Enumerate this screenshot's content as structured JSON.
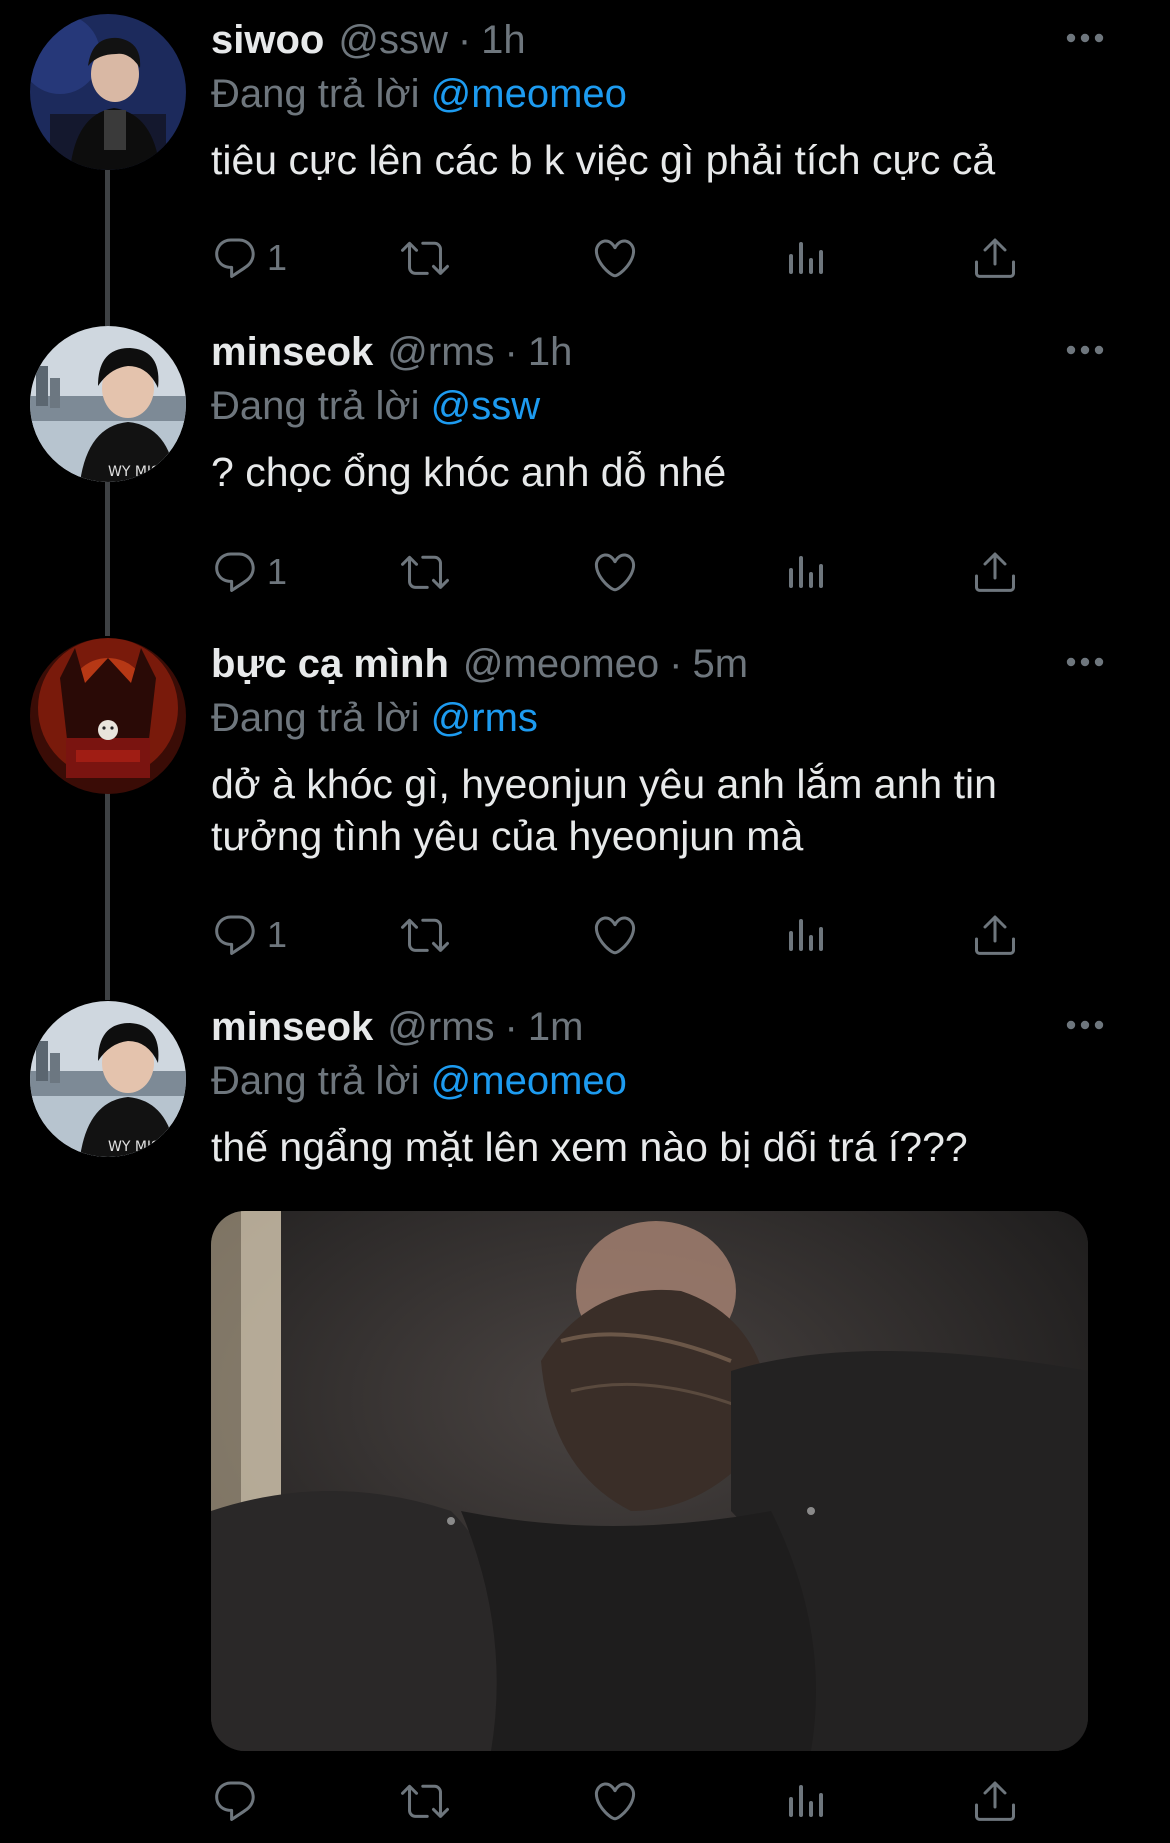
{
  "colors": {
    "background": "#000000",
    "text": "#e7e9ea",
    "muted": "#6e767d",
    "accent": "#1d9bf0",
    "thread_line": "#3e4144"
  },
  "reply_prefix": "Đang trả lời",
  "icons": {
    "reply": "reply-icon",
    "retweet": "retweet-icon",
    "like": "heart-icon",
    "views": "views-icon",
    "share": "share-icon",
    "more": "more-icon"
  },
  "tweets": [
    {
      "name": "siwoo",
      "handle": "@ssw",
      "time": "1h",
      "reply_to": "@meomeo",
      "text": "tiêu cực lên các b k việc gì phải tích cực cả",
      "reply_count": "1"
    },
    {
      "name": "minseok",
      "handle": "@rms",
      "time": "1h",
      "reply_to": "@ssw",
      "text": "? chọc ổng khóc anh dỗ nhé",
      "reply_count": "1"
    },
    {
      "name": "bực cạ mình",
      "handle": "@meomeo",
      "time": "5m",
      "reply_to": "@rms",
      "text": "dở à khóc gì, hyeonjun yêu anh lắm anh tin tưởng tình yêu của hyeonjun mà",
      "reply_count": "1"
    },
    {
      "name": "minseok",
      "handle": "@rms",
      "time": "1m",
      "reply_to": "@meomeo",
      "text": "thế ngẩng mặt lên xem nào bị dối trá í???",
      "reply_count": ""
    }
  ]
}
